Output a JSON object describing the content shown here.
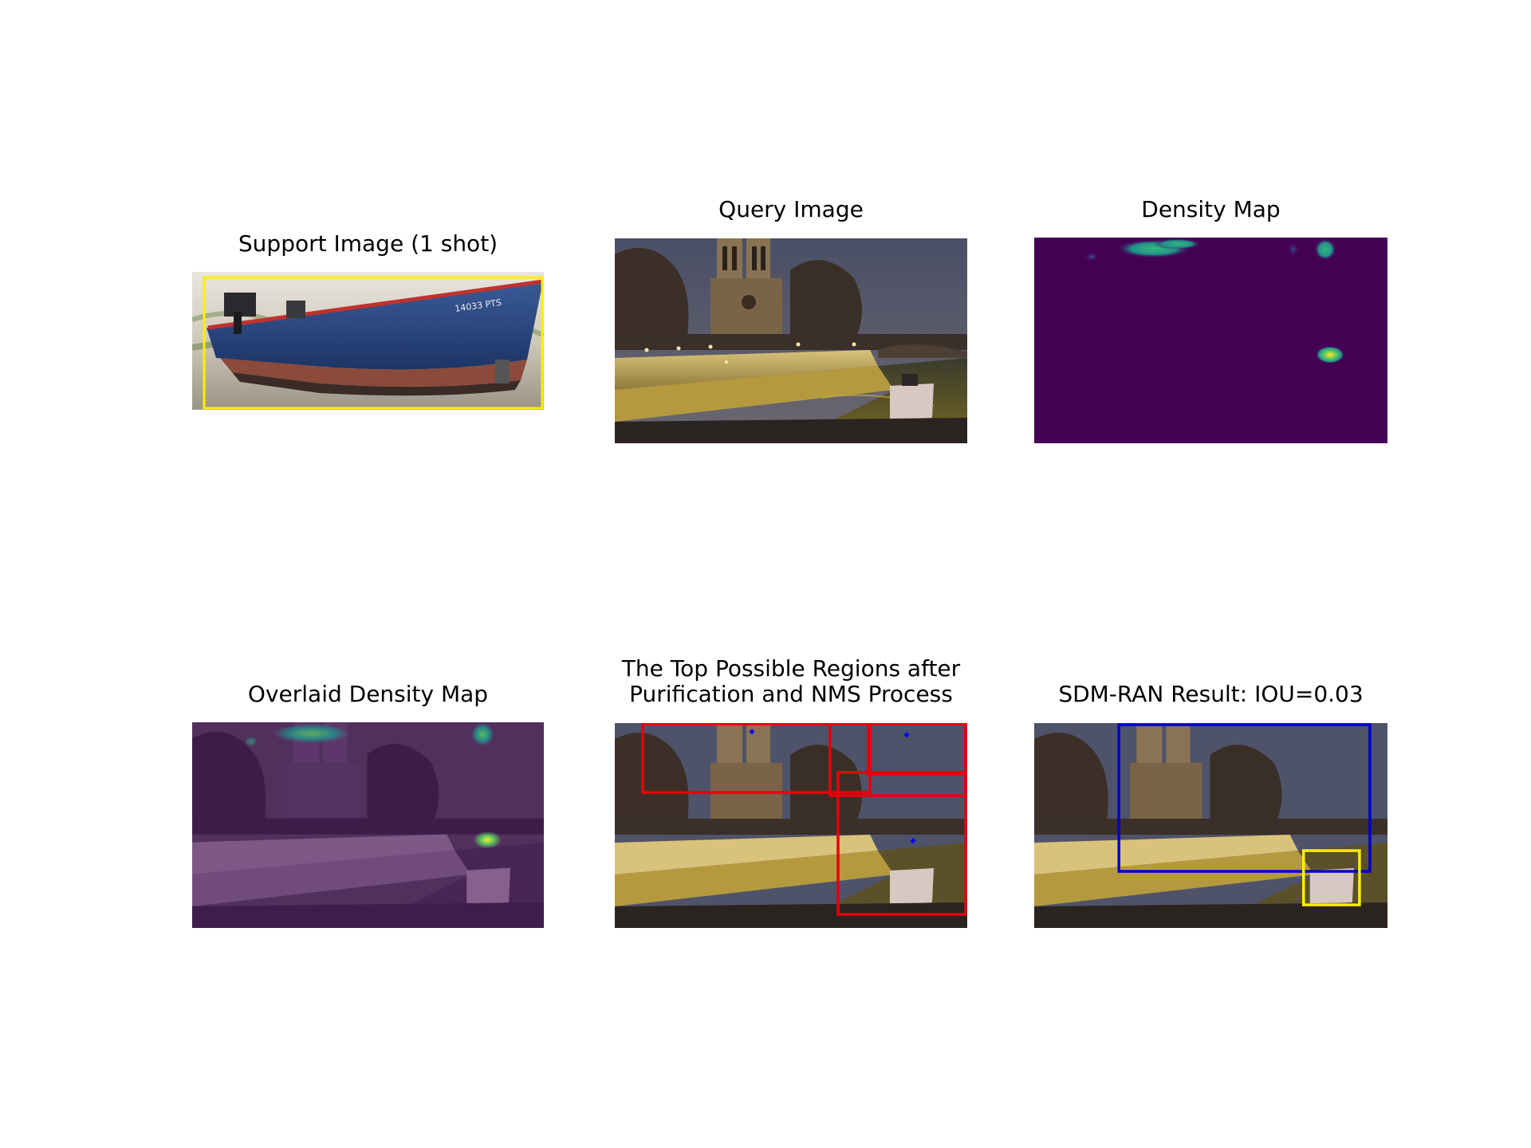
{
  "figure": {
    "panels": [
      {
        "id": "support",
        "title": "Support Image (1 shot)"
      },
      {
        "id": "query",
        "title": "Query Image"
      },
      {
        "id": "density",
        "title": "Density Map"
      },
      {
        "id": "overlaid",
        "title": "Overlaid Density Map"
      },
      {
        "id": "regions",
        "title": "The Top Possible Regions after\nPurification and NMS Process"
      },
      {
        "id": "result",
        "title": "SDM-RAN Result: IOU=0.03"
      }
    ],
    "support_label_text": "14033 PTS",
    "colors": {
      "density_background": "#440154",
      "hotspot_yellow": "#fde725",
      "hotspot_green": "#35b779",
      "hotspot_teal": "#21918c",
      "candidate_box": "#e8000b",
      "prediction_box": "#0000cc",
      "ground_truth_box": "#ffee00"
    }
  }
}
